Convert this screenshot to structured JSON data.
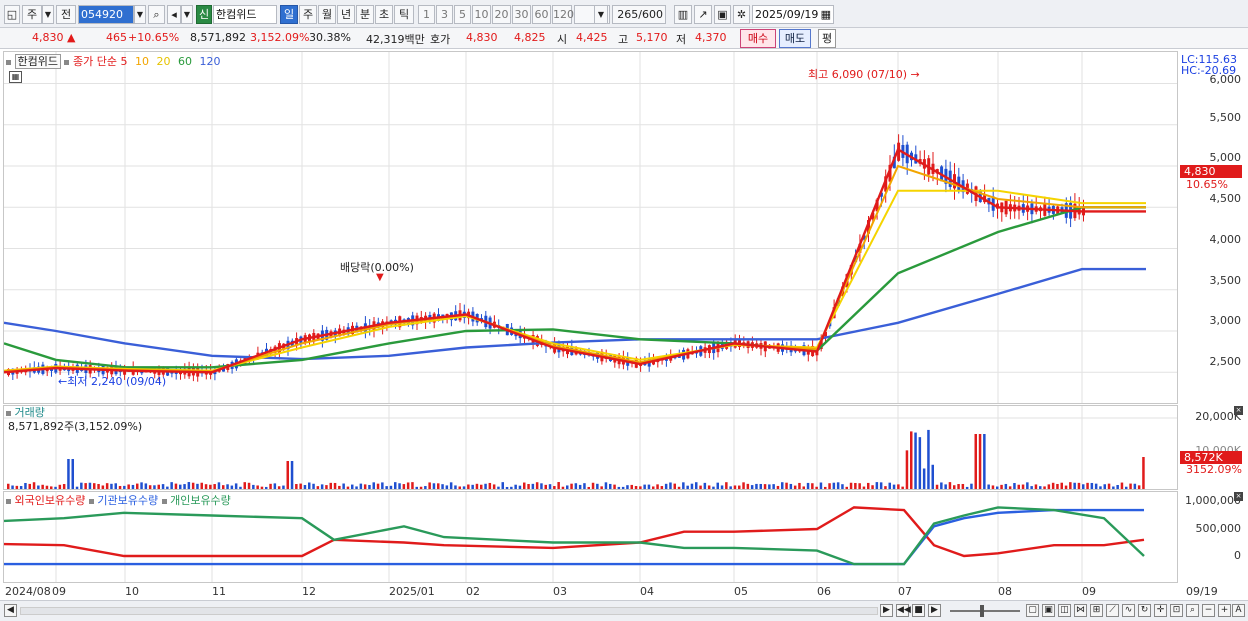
{
  "toolbar": {
    "period_label": "주",
    "prev_label": "전",
    "stock_code": "054920",
    "shin_label": "신",
    "stock_name": "한컴위드",
    "intervals": [
      "일",
      "주",
      "월",
      "년",
      "분",
      "초",
      "틱"
    ],
    "minute_options": [
      "1",
      "3",
      "5",
      "10",
      "20",
      "30",
      "60",
      "120"
    ],
    "count": "265",
    "count_max": "/600",
    "date": "2025/09/19"
  },
  "info": {
    "price": "4,830",
    "up_arrow": "▲",
    "change": "465",
    "change_pct": "+10.65%",
    "volume": "8,571,892",
    "volume_ratio": "3,152.09%",
    "turnover": "30.38%",
    "amount": "42,319백만",
    "quote_label": "호가",
    "ask": "4,830",
    "bid": "4,825",
    "open_label": "시",
    "open": "4,425",
    "high_label": "고",
    "high": "5,170",
    "low_label": "저",
    "low": "4,370",
    "buy_label": "매수",
    "sell_label": "매도",
    "eval_label": "평"
  },
  "price_pane": {
    "stock_label": "한컴위드",
    "ma_label": "종가 단순",
    "ma_periods": [
      "5",
      "10",
      "20",
      "60",
      "120"
    ],
    "ma_colors": [
      "#e01b1b",
      "#f2a500",
      "#f5d400",
      "#2a9a3c",
      "#3a5fd8"
    ],
    "lc": "LC:115.63",
    "hc": "HC:-20.69",
    "high_annot": "최고 6,090 (07/10)",
    "low_annot": "최저 2,240 (09/04)",
    "dividend_annot": "배당락(0.00%)",
    "current_price": "4,830",
    "current_pct": "10.65%",
    "y_ticks": [
      "6,000",
      "5,500",
      "5,000",
      "4,500",
      "4,000",
      "3,500",
      "3,000",
      "2,500"
    ]
  },
  "volume_pane": {
    "title": "거래량",
    "value": "8,571,892주(3,152.09%)",
    "tick_top": "20,000K",
    "tick_mid": "10,000K",
    "current": "8,572K",
    "current_pct": "3152.09%"
  },
  "holdings_pane": {
    "series": [
      "외국인보유수량",
      "기관보유수량",
      "개인보유수량"
    ],
    "colors": [
      "#e01b1b",
      "#2a5fe0",
      "#2a9a5a"
    ],
    "y_ticks": [
      "1,000,000",
      "500,000",
      "0"
    ]
  },
  "x_axis": [
    "2024/08",
    "09",
    "10",
    "11",
    "12",
    "2025/01",
    "02",
    "03",
    "04",
    "05",
    "06",
    "07",
    "08",
    "09",
    "09/19"
  ],
  "chart_data": {
    "type": "line",
    "title": "",
    "xlabel": "",
    "ylabel": "",
    "ylim": [
      2200,
      6200
    ],
    "x": [
      "2024/08",
      "09",
      "10",
      "11",
      "12",
      "2025/01",
      "02",
      "03",
      "04",
      "05",
      "06",
      "07",
      "08",
      "09"
    ],
    "series": [
      {
        "name": "5",
        "values": [
          2500,
          2550,
          2520,
          2500,
          2900,
          3100,
          3200,
          2800,
          2600,
          2850,
          2750,
          5200,
          4500,
          4450
        ]
      },
      {
        "name": "10",
        "values": [
          2510,
          2560,
          2530,
          2510,
          2850,
          3080,
          3200,
          2820,
          2620,
          2840,
          2780,
          5000,
          4600,
          4500
        ]
      },
      {
        "name": "20",
        "values": [
          2520,
          2570,
          2540,
          2520,
          2800,
          3050,
          3180,
          2850,
          2650,
          2830,
          2800,
          4700,
          4700,
          4550
        ]
      },
      {
        "name": "60",
        "values": [
          2850,
          2650,
          2560,
          2560,
          2650,
          2850,
          3000,
          3020,
          2900,
          2850,
          2760,
          3700,
          4200,
          4500
        ]
      },
      {
        "name": "120",
        "values": [
          3100,
          3000,
          2850,
          2700,
          2660,
          2700,
          2800,
          2860,
          2900,
          2900,
          2900,
          3100,
          3450,
          3750
        ]
      }
    ]
  }
}
